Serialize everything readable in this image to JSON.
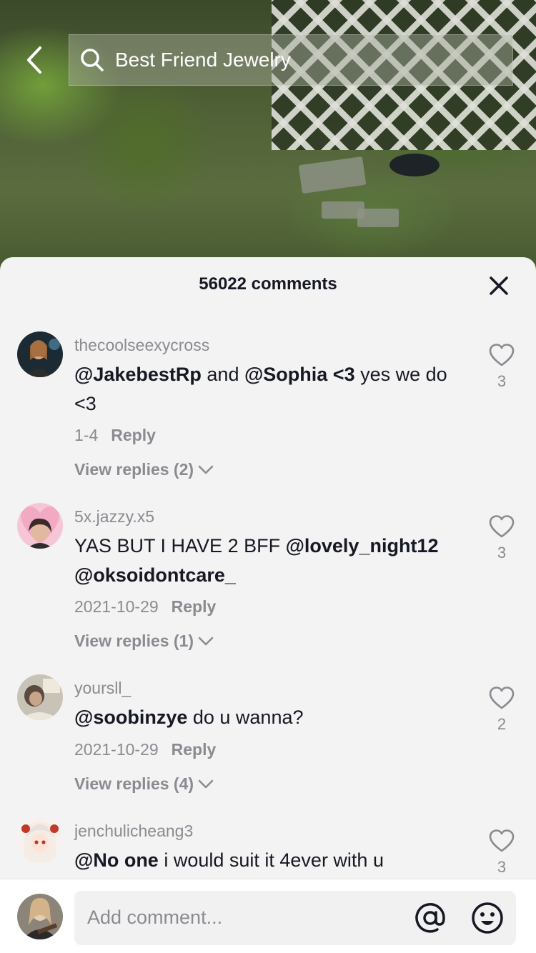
{
  "search": {
    "query": "Best Friend Jewelry"
  },
  "sheet": {
    "title": "56022 comments"
  },
  "comments": [
    {
      "username": "thecoolseexycross",
      "text_parts": [
        {
          "t": "@JakebestRp",
          "b": true
        },
        {
          "t": " and ",
          "b": false
        },
        {
          "t": "@Sophia <3",
          "b": true
        },
        {
          "t": " yes we do <3",
          "b": false
        }
      ],
      "date": "1-4",
      "reply": "Reply",
      "view_replies": "View replies (2)",
      "likes": "3"
    },
    {
      "username": "5x.jazzy.x5",
      "text_parts": [
        {
          "t": "YAS BUT I HAVE 2 BFF ",
          "b": false
        },
        {
          "t": "@lovely_night12 @oksoidontcare_",
          "b": true
        }
      ],
      "date": "2021-10-29",
      "reply": "Reply",
      "view_replies": "View replies (1)",
      "likes": "3"
    },
    {
      "username": "yoursll_",
      "text_parts": [
        {
          "t": "@soobinzye",
          "b": true
        },
        {
          "t": " do u wanna?",
          "b": false
        }
      ],
      "date": "2021-10-29",
      "reply": "Reply",
      "view_replies": "View replies (4)",
      "likes": "2"
    },
    {
      "username": "jenchulicheang3",
      "text_parts": [
        {
          "t": "@No one",
          "b": true
        },
        {
          "t": " i would suit it 4ever with u",
          "b": false
        }
      ],
      "likes": "3"
    }
  ],
  "composer": {
    "placeholder": "Add comment..."
  },
  "icons": {
    "back": "chevron-left-icon",
    "search": "search-icon",
    "close": "close-icon",
    "like": "heart-outline-icon",
    "expand": "chevron-down-icon",
    "mention": "at-sign-icon",
    "emoji": "emoji-icon"
  },
  "colors": {
    "text_primary": "#161823",
    "text_secondary": "#8a8b91",
    "sheet_bg": "#f3f3f3"
  }
}
